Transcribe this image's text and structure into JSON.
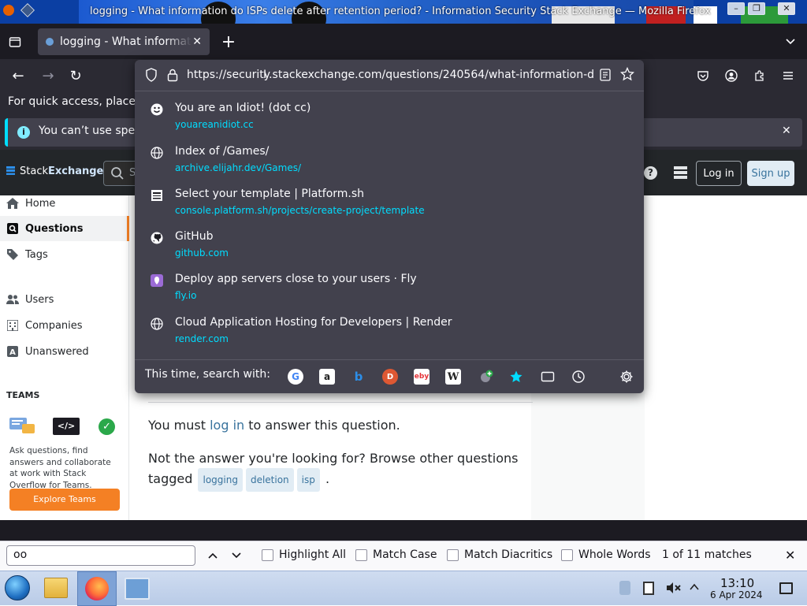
{
  "window": {
    "title": "logging - What information do ISPs delete after retention period? - Information Security Stack Exchange — Mozilla Firefox"
  },
  "tab": {
    "label": "logging - What informati"
  },
  "urlbar": {
    "url": "https://security.stackexchange.com/questions/240564/what-information-d"
  },
  "suggestions": [
    {
      "title": "You are an Idiot! (dot cc)",
      "url": "youareanidiot.cc",
      "icon": "smiley-icon"
    },
    {
      "title": "Index of /Games/",
      "url": "archive.elijahr.dev/Games/",
      "icon": "globe-icon"
    },
    {
      "title": "Select your template | Platform.sh",
      "url": "console.platform.sh/projects/create-project/template",
      "icon": "platformsh-icon"
    },
    {
      "title": "GitHub",
      "url": "github.com",
      "icon": "github-icon"
    },
    {
      "title": "Deploy app servers close to your users · Fly",
      "url": "fly.io",
      "icon": "fly-icon"
    },
    {
      "title": "Cloud Application Hosting for Developers | Render",
      "url": "render.com",
      "icon": "globe-icon"
    }
  ],
  "search_with": {
    "label": "This time, search with:"
  },
  "bookmark_hint": {
    "text": "For quick access, place y"
  },
  "infobar": {
    "text": "You can’t use spee"
  },
  "stackexchange": {
    "logo_a": "Stack",
    "logo_b": "Exchange",
    "search_placeholder": "S",
    "login": "Log in",
    "signup": "Sign up"
  },
  "leftnav": {
    "home": "Home",
    "questions": "Questions",
    "tags": "Tags",
    "users": "Users",
    "companies": "Companies",
    "unanswered": "Unanswered",
    "teams_header": "TEAMS",
    "teams_text": "Ask questions, find answers and collaborate at work with Stack Overflow for Teams.",
    "explore": "Explore Teams"
  },
  "main": {
    "must_a": "You must ",
    "must_link": "log in",
    "must_b": " to answer this question.",
    "browse": "Not the answer you're looking for? Browse other questions tagged",
    "tags": [
      "logging",
      "deletion",
      "isp"
    ],
    "period": "."
  },
  "findbar": {
    "query": "oo",
    "highlight_all": "Highlight All",
    "match_case": "Match Case",
    "match_diacritics": "Match Diacritics",
    "whole_words": "Whole Words",
    "result": "1 of 11 matches"
  },
  "clock": {
    "time": "13:10",
    "date": "6 Apr 2024"
  },
  "colors": {
    "accent": "#00ddff",
    "so_orange": "#f48024",
    "so_blue": "#0a95ff"
  }
}
